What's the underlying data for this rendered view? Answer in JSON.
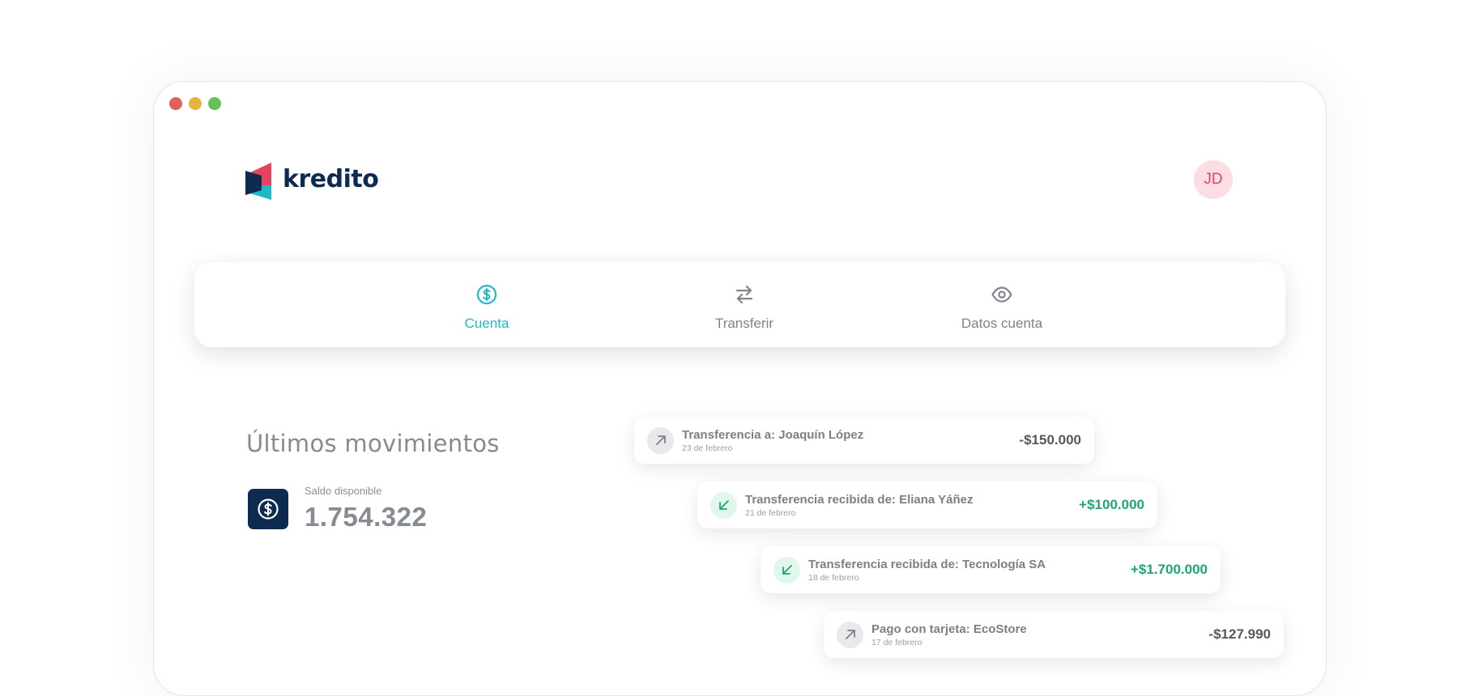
{
  "brand": {
    "name": "kredito"
  },
  "user": {
    "initials": "JD"
  },
  "tabs": [
    {
      "label": "Cuenta",
      "icon": "dollar-circle-icon",
      "active": true
    },
    {
      "label": "Transferir",
      "icon": "transfer-arrows-icon",
      "active": false
    },
    {
      "label": "Datos cuenta",
      "icon": "eye-icon",
      "active": false
    }
  ],
  "movements": {
    "title": "Últimos movimientos",
    "balance_label": "Saldo disponible",
    "balance_value": "1.754.322",
    "balance_icon": "dollar-circle-icon"
  },
  "transactions": [
    {
      "title": "Transferencia a: Joaquín López",
      "date": "23 de febrero",
      "amount": "-$150.000",
      "direction": "out"
    },
    {
      "title": "Transferencia recibida de: Eliana Yáñez",
      "date": "21 de febrero",
      "amount": "+$100.000",
      "direction": "in"
    },
    {
      "title": "Transferencia recibida de: Tecnología SA",
      "date": "18 de febrero",
      "amount": "+$1.700.000",
      "direction": "in"
    },
    {
      "title": "Pago con tarjeta: EcoStore",
      "date": "17 de febrero",
      "amount": "-$127.990",
      "direction": "out"
    }
  ],
  "colors": {
    "brand_navy": "#0d2b4e",
    "brand_pink": "#e5435f",
    "brand_teal": "#1fb8c9",
    "positive_green": "#1ea57a"
  }
}
